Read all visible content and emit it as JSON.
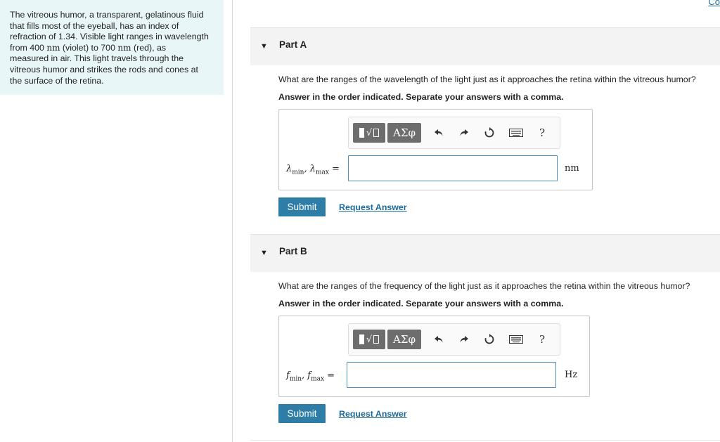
{
  "top_link": "Co",
  "intro": {
    "line1": "The vitreous humor, a transparent, gelatinous fluid",
    "line2": "that fills most of the eyeball, has an index of",
    "line3": "refraction of 1.34. Visible light ranges in wavelength",
    "line4_a": "from 400 ",
    "line4_unit1": "nm",
    "line4_b": " (violet) to 700 ",
    "line4_unit2": "nm",
    "line4_c": " (red), as",
    "line5": "measured in air. This light travels through the",
    "line6": "vitreous humor and strikes the rods and cones at",
    "line7": "the surface of the retina."
  },
  "parts": [
    {
      "title": "Part A",
      "question": "What are the ranges of the wavelength of the light just as it approaches the retina within the vitreous humor?",
      "instruction": "Answer in the order indicated. Separate your answers with a comma.",
      "var1": "λ",
      "var1_sub": "min",
      "var2": "λ",
      "var2_sub": "max",
      "equals": "=",
      "input_value": "",
      "unit": "nm",
      "submit_label": "Submit",
      "request_label": "Request Answer"
    },
    {
      "title": "Part B",
      "question": "What are the ranges of the frequency of the light just as it approaches the retina within the vitreous humor?",
      "instruction": "Answer in the order indicated. Separate your answers with a comma.",
      "var1": "f",
      "var1_sub": "min",
      "var2": "f",
      "var2_sub": "max",
      "equals": "=",
      "input_value": "",
      "unit": "Hz",
      "submit_label": "Submit",
      "request_label": "Request Answer"
    }
  ],
  "toolbar": {
    "greek_label": "ΑΣφ",
    "help_label": "?",
    "icons": [
      "templates-icon",
      "greek-symbols-icon",
      "undo-icon",
      "redo-icon",
      "reset-icon",
      "keyboard-icon",
      "help-icon"
    ]
  },
  "colors": {
    "intro_bg": "#e9f6f7",
    "submit_bg": "#2e7da6",
    "link": "#1a6b9c",
    "input_border": "#4a90c2"
  }
}
